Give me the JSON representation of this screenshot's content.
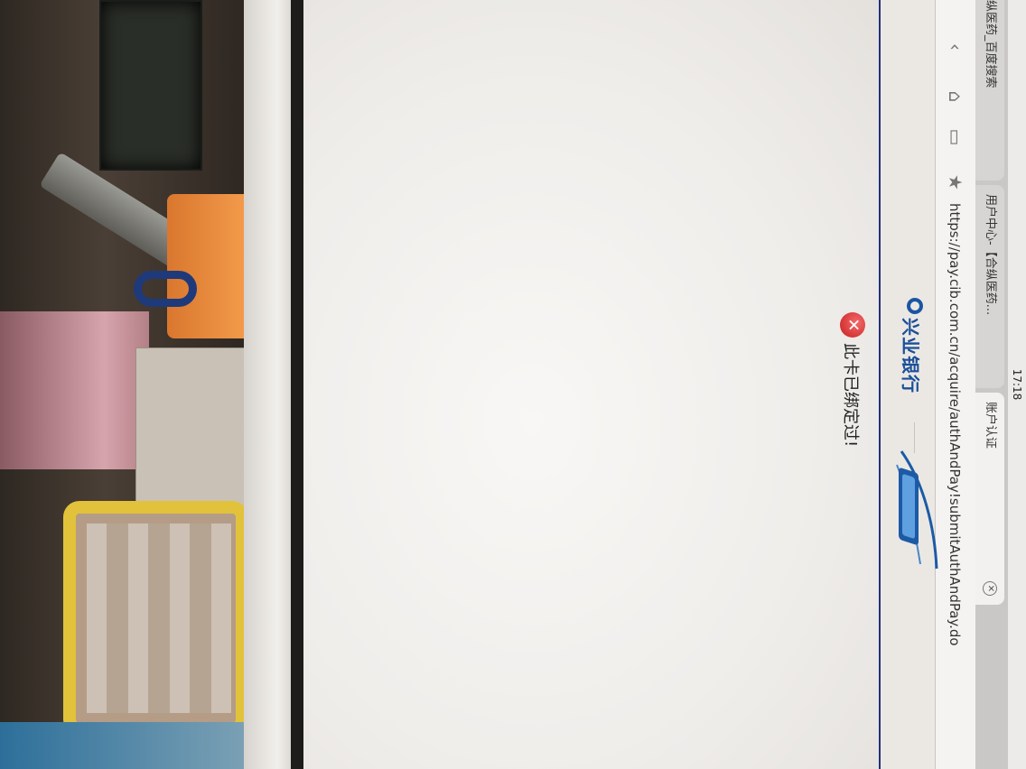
{
  "status_bar": {
    "time": "17:18"
  },
  "tabs": [
    {
      "label": "纵医药_百度搜索"
    },
    {
      "label": "用户中心-【合纵医药..."
    },
    {
      "label": "账户认证"
    }
  ],
  "toolbar": {
    "url": "https://pay.cib.com.cn/acquire/authAndPay!submitAuthAndPay.do",
    "icons": [
      "back-icon",
      "home-icon",
      "tabs-icon",
      "bookmark-star-icon"
    ]
  },
  "page": {
    "bank_logo": {
      "name": "兴业银行"
    },
    "error_message": "此卡已绑定过!"
  }
}
